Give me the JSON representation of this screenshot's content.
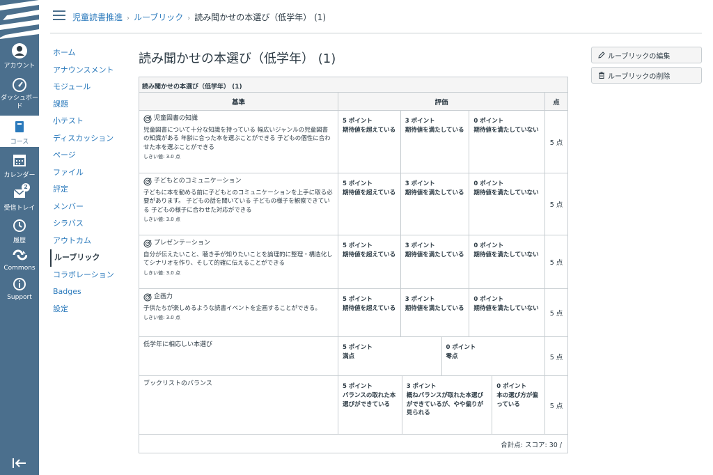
{
  "global_nav": {
    "account": "アカウント",
    "dashboard": "ダッシュボード",
    "courses": "コース",
    "calendar": "カレンダー",
    "inbox": "受信トレイ",
    "inbox_badge": "2",
    "history": "履歴",
    "commons": "Commons",
    "support": "Support"
  },
  "breadcrumb": {
    "course": "児童読書推進",
    "section": "ルーブリック",
    "current": "読み聞かせの本選び（低学年） (1)"
  },
  "course_nav": [
    "ホーム",
    "アナウンスメント",
    "モジュール",
    "課題",
    "小テスト",
    "ディスカッション",
    "ページ",
    "ファイル",
    "評定",
    "メンバー",
    "シラバス",
    "アウトカム",
    "ルーブリック",
    "コラボレーション",
    "Badges",
    "設定"
  ],
  "page_title": "読み聞かせの本選び（低学年） (1)",
  "actions": {
    "edit": "ルーブリックの編集",
    "delete": "ルーブリックの削除"
  },
  "rubric": {
    "caption": "読み聞かせの本選び（低学年） (1)",
    "headers": {
      "criteria": "基準",
      "ratings": "評価",
      "points": "点"
    },
    "rows": [
      {
        "name": "児童図書の知識",
        "desc": "児童図書について十分な知識を持っている 幅広いジャンルの児童図書の知識がある 年齢に合った本を選ぶことができる 子どもの個性に合わせた本を選ぶことができる",
        "threshold": "しきい値: 3.0 点",
        "ratings": [
          {
            "pts": "5 ポイント",
            "label": "期待値を超えている"
          },
          {
            "pts": "3 ポイント",
            "label": "期待値を満たしている"
          },
          {
            "pts": "0 ポイント",
            "label": "期待値を満たしていない"
          }
        ],
        "points": "5 点"
      },
      {
        "name": "子どもとのコミュニケーション",
        "desc": "子どもに本を勧める前に子どもとのコミュニケーションを上手に取る必要があります。 子どもの話を聞いている 子どもの様子を観察できている 子どもの様子に合わせた対応ができる",
        "threshold": "しきい値: 3.0 点",
        "ratings": [
          {
            "pts": "5 ポイント",
            "label": "期待値を超えている"
          },
          {
            "pts": "3 ポイント",
            "label": "期待値を満たしている"
          },
          {
            "pts": "0 ポイント",
            "label": "期待値を満たしていない"
          }
        ],
        "points": "5 点"
      },
      {
        "name": "プレゼンテーション",
        "desc": "自分が伝えたいこと、聴き手が知りたいことを論理的に整理・構造化してシナリオを作り、そして的確に伝えることができる",
        "threshold": "しきい値: 3.0 点",
        "ratings": [
          {
            "pts": "5 ポイント",
            "label": "期待値を超えている"
          },
          {
            "pts": "3 ポイント",
            "label": "期待値を満たしている"
          },
          {
            "pts": "0 ポイント",
            "label": "期待値を満たしていない"
          }
        ],
        "points": "5 点"
      },
      {
        "name": "企画力",
        "desc": "子供たちが楽しめるような読書イベントを企画することができる。",
        "threshold": "しきい値: 3.0 点",
        "ratings": [
          {
            "pts": "5 ポイント",
            "label": "期待値を超えている"
          },
          {
            "pts": "3 ポイント",
            "label": "期待値を満たしている"
          },
          {
            "pts": "0 ポイント",
            "label": "期待値を満たしていない"
          }
        ],
        "points": "5 点"
      },
      {
        "name": "低学年に相応しい本選び",
        "ratings": [
          {
            "pts": "5 ポイント",
            "label": "満点"
          },
          {
            "pts": "0 ポイント",
            "label": "零点"
          }
        ],
        "points": "5 点"
      },
      {
        "name": "ブックリストのバランス",
        "ratings": [
          {
            "pts": "5 ポイント",
            "label": "バランスの取れた本選びができている"
          },
          {
            "pts": "3 ポイント",
            "label": "概ねバランスが取れた本選びができているが、やや偏りが見られる"
          },
          {
            "pts": "0 ポイント",
            "label": "本の選び方が偏っている"
          }
        ],
        "points": "5 点"
      }
    ],
    "total": "合計点: スコア: 30 /"
  }
}
